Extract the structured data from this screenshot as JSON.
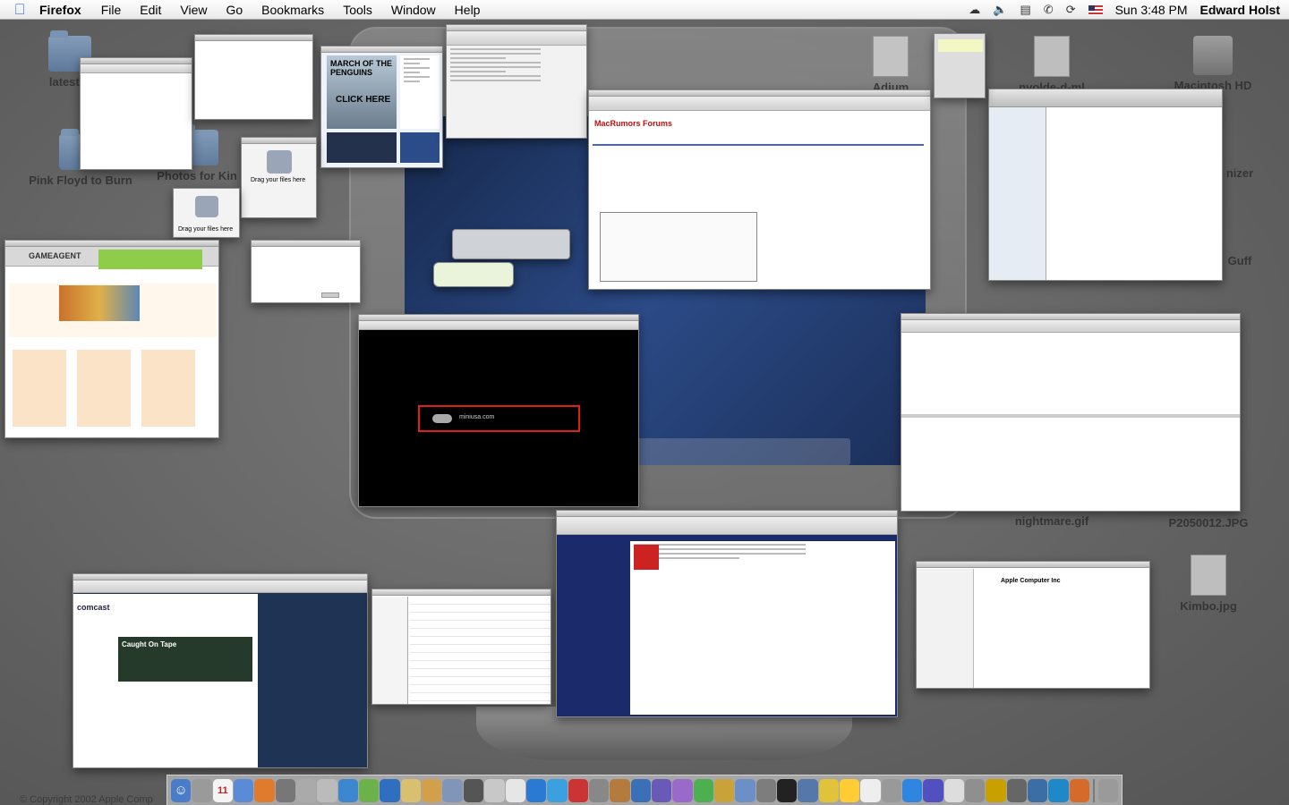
{
  "menubar": {
    "app_name": "Firefox",
    "menus": [
      "File",
      "Edit",
      "View",
      "Go",
      "Bookmarks",
      "Tools",
      "Window",
      "Help"
    ],
    "clock": "Sun 3:48 PM",
    "user": "Edward Holst"
  },
  "desktop_icons": {
    "latest": "latest E",
    "pink_floyd": "Pink Floyd to Burn",
    "photos": "Photos for Kin",
    "adium": "Adium",
    "installer": "nvolde-d-ml",
    "hd": "Macintosh HD",
    "nightmare": "nightmare.gif",
    "p2050": "P2050012.JPG",
    "kimbo": "Kimbo.jpg",
    "organizer": "nizer",
    "guff": "Guff"
  },
  "windows": {
    "penguins_ad": "MARCH OF THE PENGUINS",
    "penguins_click": "CLICK HERE",
    "drag_files_1": "Drag your files here",
    "drag_files_2": "Drag your files here",
    "gameagent": "GAMEAGENT",
    "macrumors": "MacRumors Forums",
    "mini_url": "miniusa.com",
    "comcast": "comcast",
    "comcast_headline": "Caught On Tape",
    "apple_computer": "Apple Computer Inc"
  },
  "dock": {
    "items": [
      "finder-icon",
      "calendar-icon",
      "firefox-icon",
      "mail-icon",
      "itunes-icon",
      "safari-icon",
      "ichat-icon",
      "system-prefs-icon",
      "terminal-icon",
      "trash-icon"
    ]
  },
  "copyright": "© Copyright 2002 Apple Comp"
}
